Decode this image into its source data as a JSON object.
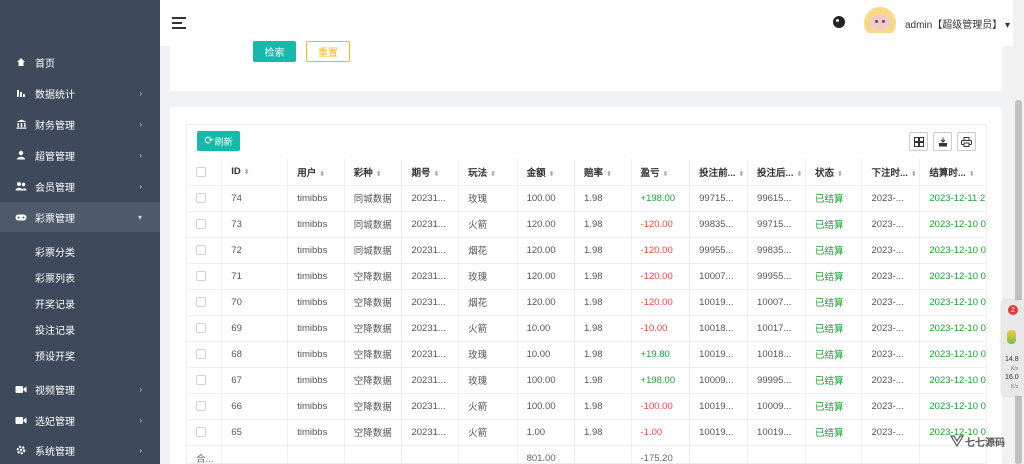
{
  "sidebar": {
    "menu": [
      {
        "icon": "home-icon",
        "label": "首页"
      },
      {
        "icon": "bar-chart-icon",
        "label": "数据统计"
      },
      {
        "icon": "bank-icon",
        "label": "财务管理"
      },
      {
        "icon": "user-icon",
        "label": "超管管理"
      },
      {
        "icon": "users-icon",
        "label": "会员管理"
      },
      {
        "icon": "gamepad-icon",
        "label": "彩票管理"
      },
      {
        "icon": "video-icon",
        "label": "视频管理"
      },
      {
        "icon": "video-icon",
        "label": "选妃管理"
      },
      {
        "icon": "gear-icon",
        "label": "系统管理"
      }
    ],
    "submenu": [
      "彩票分类",
      "彩票列表",
      "开奖记录",
      "投注记录",
      "预设开奖"
    ]
  },
  "header": {
    "user": "admin【超级管理员】",
    "caret": "▾"
  },
  "search": {
    "search_label": "检索",
    "reset_label": "重置"
  },
  "table": {
    "refresh_label": "刷新",
    "sort_icon": "⬍",
    "columns": [
      "ID",
      "用户",
      "彩种",
      "期号",
      "玩法",
      "金额",
      "赔率",
      "盈亏",
      "投注前...",
      "投注后...",
      "状态",
      "下注时...",
      "结算时..."
    ],
    "rows": [
      [
        "74",
        "timibbs",
        "同城数据",
        "20231...",
        "玫瑰",
        "100.00",
        "1.98",
        "+198.00",
        "99715...",
        "99615...",
        "已结算",
        "2023-...",
        "2023-12-11 2"
      ],
      [
        "73",
        "timibbs",
        "同城数据",
        "20231...",
        "火箭",
        "120.00",
        "1.98",
        "-120.00",
        "99835...",
        "99715...",
        "已结算",
        "2023-...",
        "2023-12-10 0"
      ],
      [
        "72",
        "timibbs",
        "同城数据",
        "20231...",
        "烟花",
        "120.00",
        "1.98",
        "-120.00",
        "99955...",
        "99835...",
        "已结算",
        "2023-...",
        "2023-12-10 0"
      ],
      [
        "71",
        "timibbs",
        "空降数据",
        "20231...",
        "玫瑰",
        "120.00",
        "1.98",
        "-120.00",
        "10007...",
        "99955...",
        "已结算",
        "2023-...",
        "2023-12-10 0"
      ],
      [
        "70",
        "timibbs",
        "空降数据",
        "20231...",
        "烟花",
        "120.00",
        "1.98",
        "-120.00",
        "10019...",
        "10007...",
        "已结算",
        "2023-...",
        "2023-12-10 0"
      ],
      [
        "69",
        "timibbs",
        "空降数据",
        "20231...",
        "火箭",
        "10.00",
        "1.98",
        "-10.00",
        "10018...",
        "10017...",
        "已结算",
        "2023-...",
        "2023-12-10 0"
      ],
      [
        "68",
        "timibbs",
        "空降数据",
        "20231...",
        "玫瑰",
        "10.00",
        "1.98",
        "+19.80",
        "10019...",
        "10018...",
        "已结算",
        "2023-...",
        "2023-12-10 0"
      ],
      [
        "67",
        "timibbs",
        "空降数据",
        "20231...",
        "玫瑰",
        "100.00",
        "1.98",
        "+198.00",
        "10009...",
        "99995...",
        "已结算",
        "2023-...",
        "2023-12-10 0"
      ],
      [
        "66",
        "timibbs",
        "空降数据",
        "20231...",
        "火箭",
        "100.00",
        "1.98",
        "-100.00",
        "10019...",
        "10009...",
        "已结算",
        "2023-...",
        "2023-12-10 0"
      ],
      [
        "65",
        "timibbs",
        "空降数据",
        "20231...",
        "火箭",
        "1.00",
        "1.98",
        "-1.00",
        "10019...",
        "10019...",
        "已结算",
        "2023-...",
        "2023-12-10 0"
      ]
    ],
    "total": {
      "label": "合...",
      "amount": "801.00",
      "profit": "-175.20"
    }
  },
  "widget": {
    "badge": "2",
    "stat1": "14.8",
    "unit1": "K/s",
    "stat2": "16.0",
    "unit2": "K/s"
  },
  "watermark": {
    "title": "七七源码"
  },
  "colors": {
    "sidebar": "#3e4a5b",
    "primary": "#16baaa",
    "warning": "#ffb800",
    "positive": "#1aa034",
    "negative": "#ff3f3f"
  }
}
